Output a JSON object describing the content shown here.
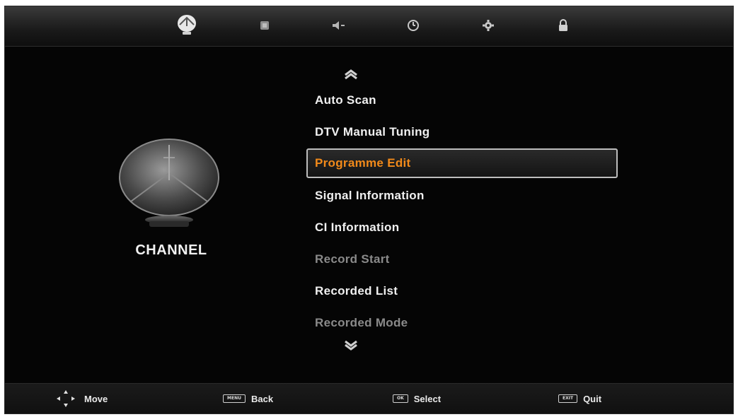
{
  "top_menu": {
    "icons": [
      {
        "name": "channel-dish-icon",
        "active": true
      },
      {
        "name": "picture-icon",
        "active": false
      },
      {
        "name": "sound-icon",
        "active": false
      },
      {
        "name": "time-icon",
        "active": false
      },
      {
        "name": "setup-icon",
        "active": false
      },
      {
        "name": "lock-icon",
        "active": false
      }
    ]
  },
  "category": {
    "label": "CHANNEL",
    "icon": "satellite-dish-icon"
  },
  "menu": {
    "items": [
      {
        "label": "Auto Scan",
        "state": "normal"
      },
      {
        "label": "DTV Manual Tuning",
        "state": "normal"
      },
      {
        "label": "Programme Edit",
        "state": "selected"
      },
      {
        "label": "Signal Information",
        "state": "normal"
      },
      {
        "label": "CI Information",
        "state": "normal"
      },
      {
        "label": "Record Start",
        "state": "disabled"
      },
      {
        "label": "Recorded List",
        "state": "normal"
      },
      {
        "label": "Recorded Mode",
        "state": "disabled"
      }
    ]
  },
  "hints": {
    "move": {
      "label": "Move",
      "icon": "dpad-icon"
    },
    "back": {
      "key": "MENU",
      "label": "Back"
    },
    "select": {
      "key": "OK",
      "label": "Select"
    },
    "quit": {
      "key": "EXIT",
      "label": "Quit"
    }
  },
  "colors": {
    "background": "#050505",
    "selected_text": "#f28a1a",
    "normal_text": "#f0f0f0",
    "disabled_text": "#8a8a8a"
  }
}
